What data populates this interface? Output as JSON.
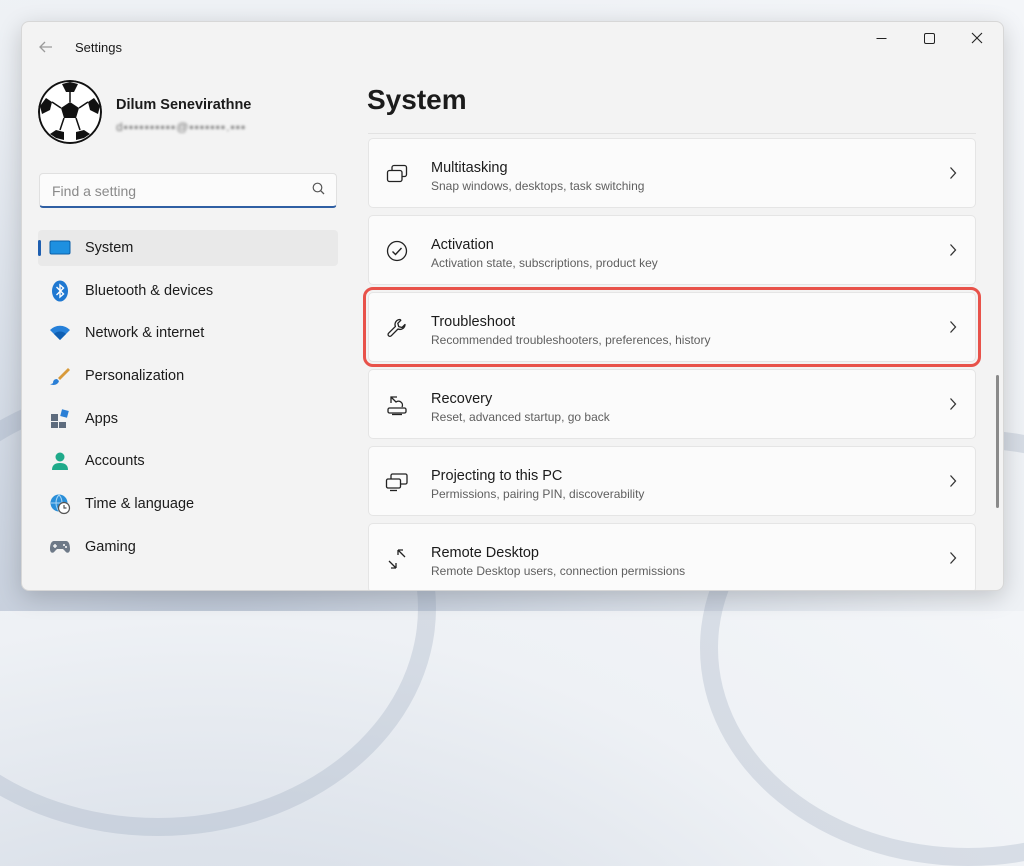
{
  "window": {
    "title": "Settings"
  },
  "user": {
    "name": "Dilum Senevirathne",
    "email": "d▪▪▪▪▪▪▪▪▪▪@▪▪▪▪▪▪▪.▪▪▪"
  },
  "search": {
    "placeholder": "Find a setting",
    "value": ""
  },
  "nav": {
    "items": [
      {
        "label": "System",
        "icon": "monitor-icon",
        "active": true
      },
      {
        "label": "Bluetooth & devices",
        "icon": "bluetooth-icon"
      },
      {
        "label": "Network & internet",
        "icon": "wifi-icon"
      },
      {
        "label": "Personalization",
        "icon": "brush-icon"
      },
      {
        "label": "Apps",
        "icon": "apps-icon"
      },
      {
        "label": "Accounts",
        "icon": "person-icon"
      },
      {
        "label": "Time & language",
        "icon": "globe-clock-icon"
      },
      {
        "label": "Gaming",
        "icon": "gamepad-icon"
      }
    ]
  },
  "main": {
    "title": "System",
    "cards": [
      {
        "title": "Multitasking",
        "desc": "Snap windows, desktops, task switching",
        "icon": "multitasking-icon"
      },
      {
        "title": "Activation",
        "desc": "Activation state, subscriptions, product key",
        "icon": "activation-check-icon"
      },
      {
        "title": "Troubleshoot",
        "desc": "Recommended troubleshooters, preferences, history",
        "icon": "wrench-icon",
        "highlighted": true
      },
      {
        "title": "Recovery",
        "desc": "Reset, advanced startup, go back",
        "icon": "recovery-icon"
      },
      {
        "title": "Projecting to this PC",
        "desc": "Permissions, pairing PIN, discoverability",
        "icon": "projecting-icon"
      },
      {
        "title": "Remote Desktop",
        "desc": "Remote Desktop users, connection permissions",
        "icon": "remote-desktop-icon"
      }
    ]
  },
  "colors": {
    "accent": "#1f5fb0",
    "highlight": "#e8524a"
  }
}
